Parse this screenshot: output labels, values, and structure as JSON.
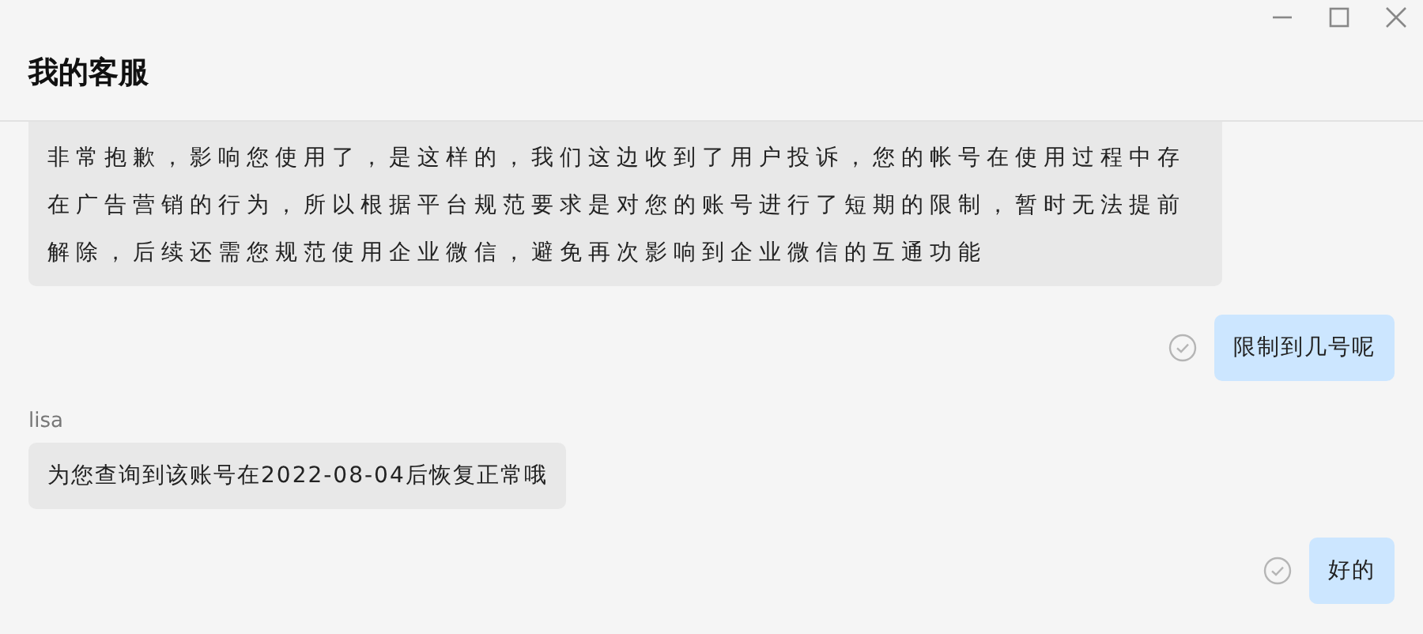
{
  "window": {
    "title": "我的客服"
  },
  "messages": [
    {
      "kind": "incoming",
      "text": "非常抱歉，影响您使用了，是这样的，我们这边收到了用户投诉，您的帐号在使用过程中存在广告营销的行为，所以根据平台规范要求是对您的账号进行了短期的限制，暂时无法提前解除，后续还需您规范使用企业微信，避免再次影响到企业微信的互通功能"
    },
    {
      "kind": "outgoing",
      "text": "限制到几号呢"
    },
    {
      "kind": "incoming",
      "sender": "lisa",
      "text": "为您查询到该账号在2022-08-04后恢复正常哦"
    },
    {
      "kind": "outgoing",
      "text": "好的"
    }
  ]
}
